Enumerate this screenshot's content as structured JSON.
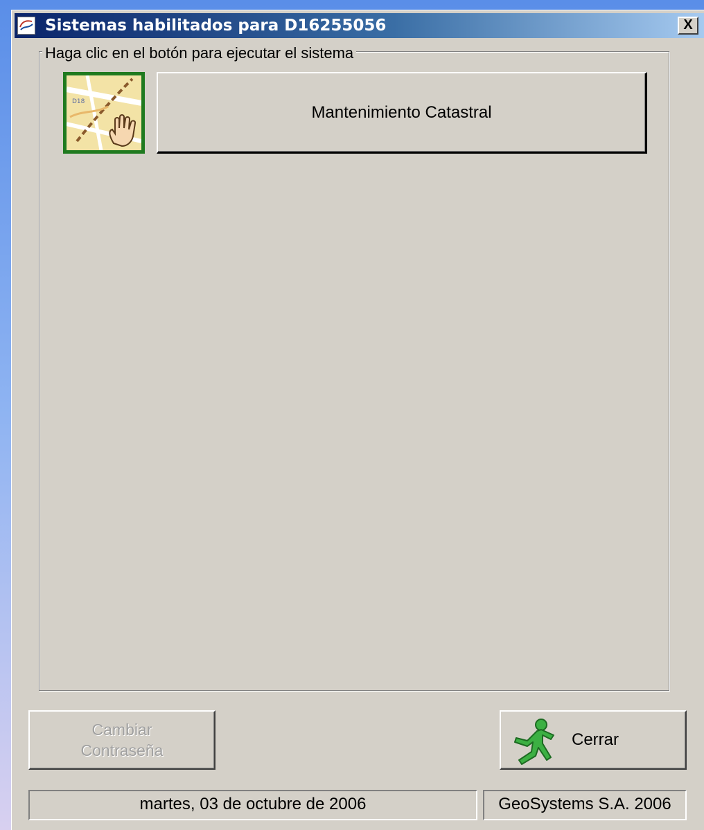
{
  "window": {
    "title": "Sistemas habilitados para D16255056",
    "close_label": "X"
  },
  "group": {
    "legend": "Haga clic en el botón para ejecutar el sistema",
    "systems": [
      {
        "label": "Mantenimiento Catastral",
        "icon": "cadastral-map-hand-icon"
      }
    ]
  },
  "buttons": {
    "change_password_line1": "Cambiar",
    "change_password_line2": "Contraseña",
    "change_password_enabled": false,
    "close_label": "Cerrar",
    "close_icon": "running-man-icon"
  },
  "status": {
    "date": "martes, 03 de octubre de 2006",
    "company": "GeoSystems S.A. 2006"
  },
  "colors": {
    "title_bar_start": "#0a246a",
    "title_bar_end": "#a6caf0",
    "face": "#d4d0c8",
    "icon_border": "#1f7a1f"
  }
}
